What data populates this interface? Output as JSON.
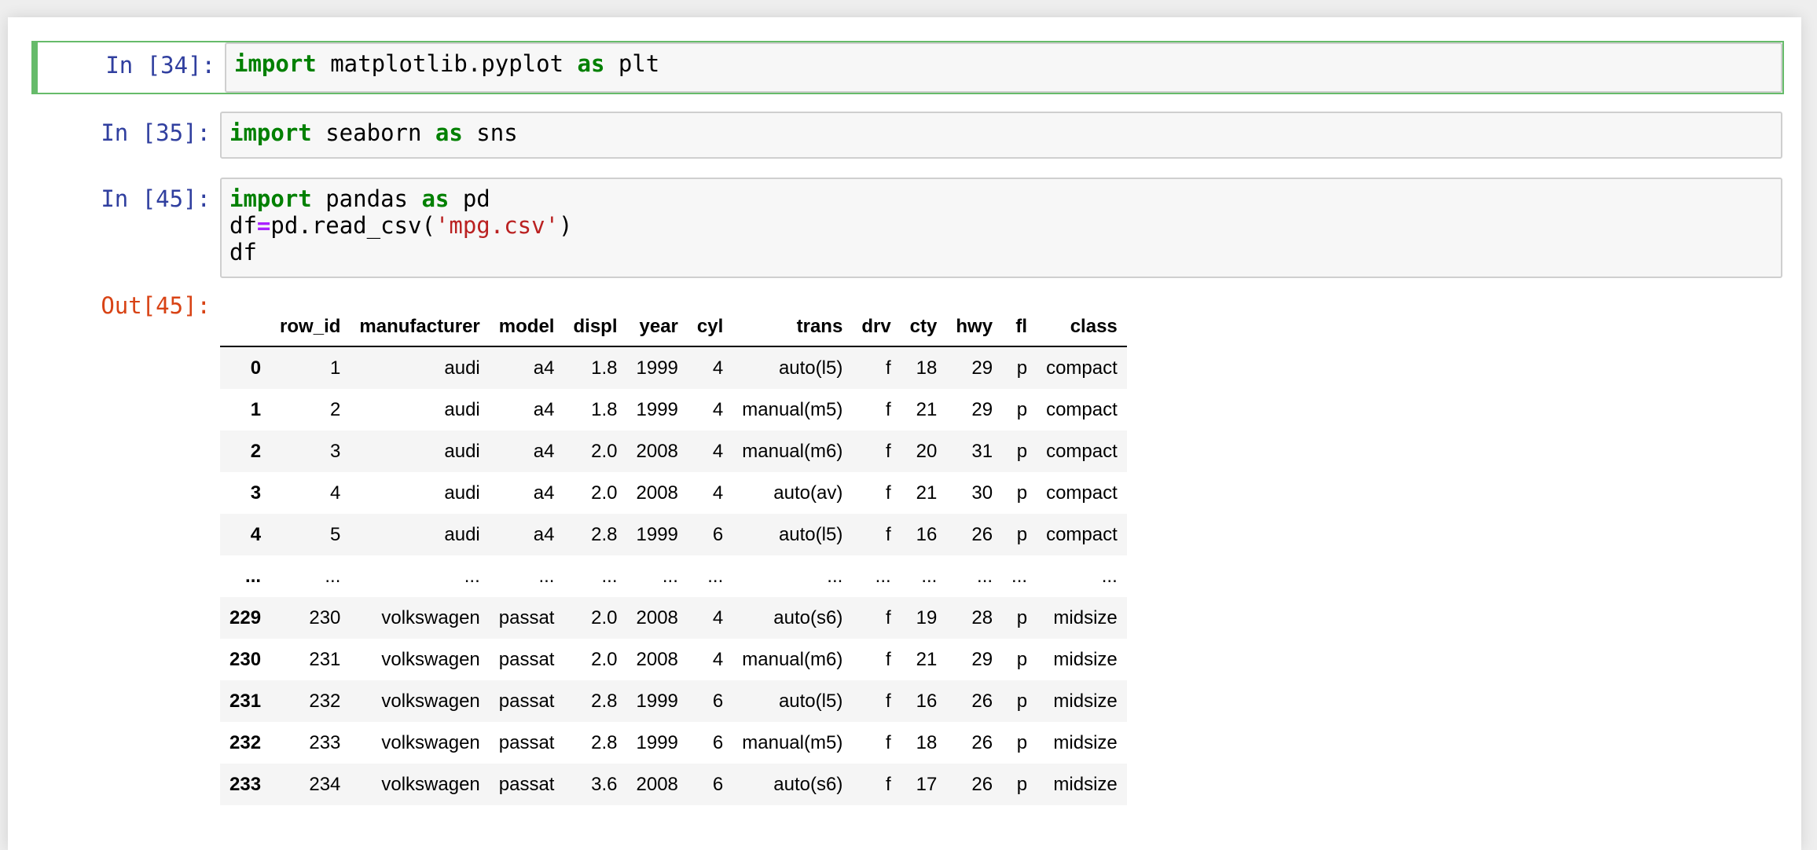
{
  "cells": [
    {
      "prompt": "In [34]:",
      "code": [
        [
          {
            "t": "import",
            "c": "kw"
          },
          {
            "t": " matplotlib.pyplot ",
            "c": ""
          },
          {
            "t": "as",
            "c": "kw"
          },
          {
            "t": " plt",
            "c": ""
          }
        ]
      ]
    },
    {
      "prompt": "In [35]:",
      "code": [
        [
          {
            "t": "import",
            "c": "kw"
          },
          {
            "t": " seaborn ",
            "c": ""
          },
          {
            "t": "as",
            "c": "kw"
          },
          {
            "t": " sns",
            "c": ""
          }
        ]
      ]
    },
    {
      "prompt": "In [45]:",
      "code": [
        [
          {
            "t": "import",
            "c": "kw"
          },
          {
            "t": " pandas ",
            "c": ""
          },
          {
            "t": "as",
            "c": "kw"
          },
          {
            "t": " pd",
            "c": ""
          }
        ],
        [
          {
            "t": "df",
            "c": ""
          },
          {
            "t": "=",
            "c": "op"
          },
          {
            "t": "pd.read_csv(",
            "c": ""
          },
          {
            "t": "'mpg.csv'",
            "c": "str"
          },
          {
            "t": ")",
            "c": ""
          }
        ],
        [
          {
            "t": "df",
            "c": ""
          }
        ]
      ]
    }
  ],
  "output": {
    "prompt": "Out[45]:",
    "columns": [
      "",
      "row_id",
      "manufacturer",
      "model",
      "displ",
      "year",
      "cyl",
      "trans",
      "drv",
      "cty",
      "hwy",
      "fl",
      "class"
    ],
    "rows": [
      [
        "0",
        "1",
        "audi",
        "a4",
        "1.8",
        "1999",
        "4",
        "auto(l5)",
        "f",
        "18",
        "29",
        "p",
        "compact"
      ],
      [
        "1",
        "2",
        "audi",
        "a4",
        "1.8",
        "1999",
        "4",
        "manual(m5)",
        "f",
        "21",
        "29",
        "p",
        "compact"
      ],
      [
        "2",
        "3",
        "audi",
        "a4",
        "2.0",
        "2008",
        "4",
        "manual(m6)",
        "f",
        "20",
        "31",
        "p",
        "compact"
      ],
      [
        "3",
        "4",
        "audi",
        "a4",
        "2.0",
        "2008",
        "4",
        "auto(av)",
        "f",
        "21",
        "30",
        "p",
        "compact"
      ],
      [
        "4",
        "5",
        "audi",
        "a4",
        "2.8",
        "1999",
        "6",
        "auto(l5)",
        "f",
        "16",
        "26",
        "p",
        "compact"
      ],
      [
        "...",
        "...",
        "...",
        "...",
        "...",
        "...",
        "...",
        "...",
        "...",
        "...",
        "...",
        "...",
        "..."
      ],
      [
        "229",
        "230",
        "volkswagen",
        "passat",
        "2.0",
        "2008",
        "4",
        "auto(s6)",
        "f",
        "19",
        "28",
        "p",
        "midsize"
      ],
      [
        "230",
        "231",
        "volkswagen",
        "passat",
        "2.0",
        "2008",
        "4",
        "manual(m6)",
        "f",
        "21",
        "29",
        "p",
        "midsize"
      ],
      [
        "231",
        "232",
        "volkswagen",
        "passat",
        "2.8",
        "1999",
        "6",
        "auto(l5)",
        "f",
        "16",
        "26",
        "p",
        "midsize"
      ],
      [
        "232",
        "233",
        "volkswagen",
        "passat",
        "2.8",
        "1999",
        "6",
        "manual(m5)",
        "f",
        "18",
        "26",
        "p",
        "midsize"
      ],
      [
        "233",
        "234",
        "volkswagen",
        "passat",
        "3.6",
        "2008",
        "6",
        "auto(s6)",
        "f",
        "17",
        "26",
        "p",
        "midsize"
      ]
    ]
  }
}
